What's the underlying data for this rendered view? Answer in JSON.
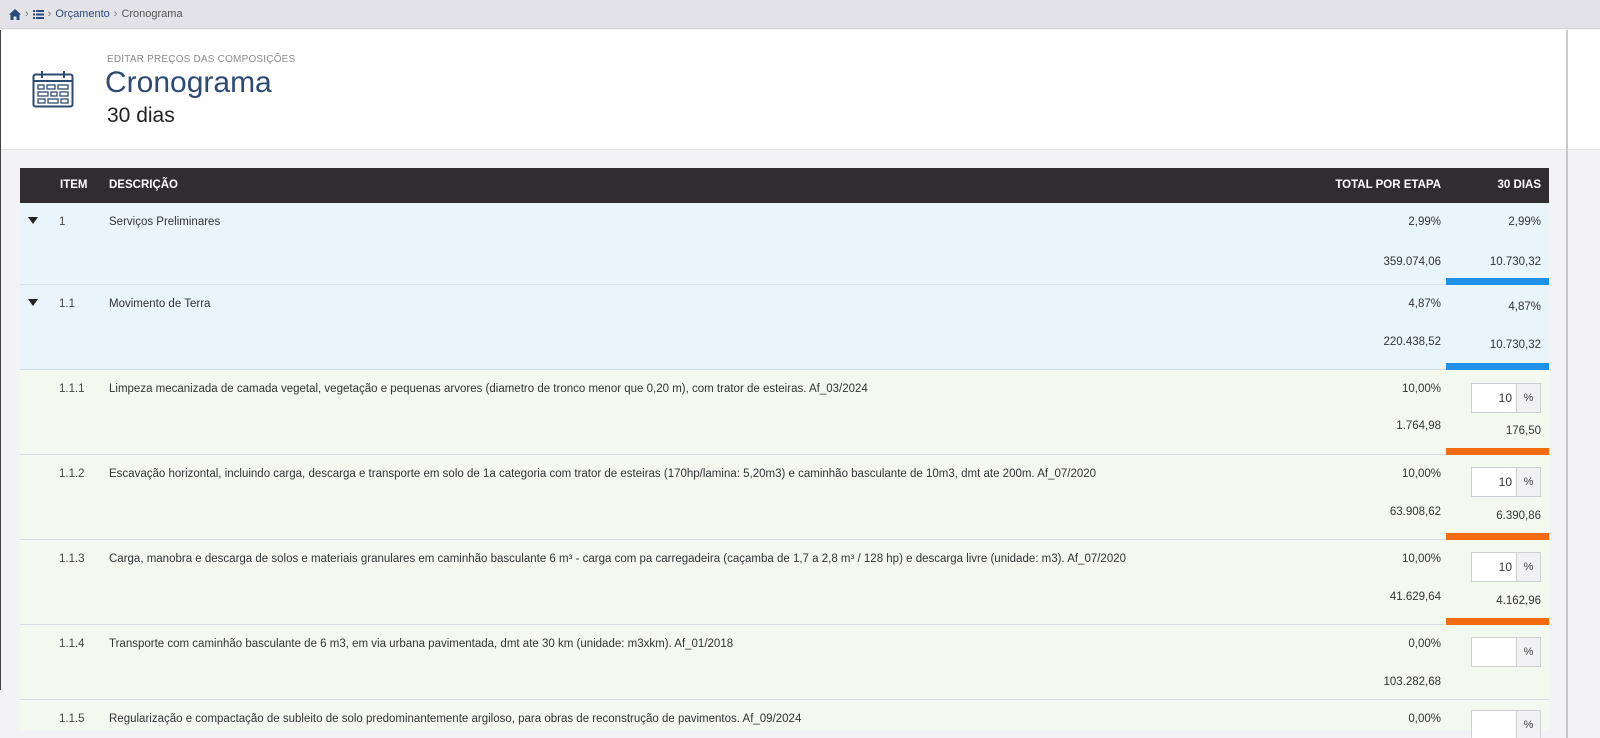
{
  "breadcrumb": {
    "items": [
      "Orçamento",
      "Cronograma"
    ]
  },
  "header": {
    "subtitle": "EDITAR PREÇOS DAS COMPOSIÇÕES",
    "title": "Cronograma",
    "period": "30 dias"
  },
  "table": {
    "columns": {
      "item": "ITEM",
      "description": "DESCRIÇÃO",
      "total": "TOTAL POR ETAPA",
      "days": "30 DIAS"
    },
    "rows": [
      {
        "item": "1",
        "description": "Serviços Preliminares",
        "total_pct": "2,99%",
        "total_value": "359.074,06",
        "day_pct": "2,99%",
        "day_value": "10.730,32"
      },
      {
        "item": "1.1",
        "description": "Movimento de Terra",
        "total_pct": "4,87%",
        "total_value": "220.438,52",
        "day_pct": "4,87%",
        "day_value": "10.730,32"
      },
      {
        "item": "1.1.1",
        "description": "Limpeza mecanizada de camada vegetal, vegetação e pequenas arvores (diametro de tronco menor que 0,20 m), com trator de esteiras. Af_03/2024",
        "total_pct": "10,00%",
        "total_value": "1.764,98",
        "input_value": "10",
        "input_unit": "%",
        "day_value": "176,50"
      },
      {
        "item": "1.1.2",
        "description": "Escavação horizontal, incluindo carga, descarga e transporte em solo de 1a categoria com trator de esteiras (170hp/lamina: 5,20m3) e caminhão basculante de 10m3, dmt ate 200m. Af_07/2020",
        "total_pct": "10,00%",
        "total_value": "63.908,62",
        "input_value": "10",
        "input_unit": "%",
        "day_value": "6.390,86"
      },
      {
        "item": "1.1.3",
        "description": "Carga, manobra e descarga de solos e materiais granulares em caminhão basculante 6 m³ - carga com pa carregadeira (caçamba de 1,7 a 2,8 m³ / 128 hp) e descarga livre (unidade: m3). Af_07/2020",
        "total_pct": "10,00%",
        "total_value": "41.629,64",
        "input_value": "10",
        "input_unit": "%",
        "day_value": "4.162,96"
      },
      {
        "item": "1.1.4",
        "description": "Transporte com caminhão basculante de 6 m3, em via urbana pavimentada, dmt ate 30 km (unidade: m3xkm). Af_01/2018",
        "total_pct": "0,00%",
        "total_value": "103.282,68",
        "input_value": "",
        "input_unit": "%"
      },
      {
        "item": "1.1.5",
        "description": "Regularização e compactação de subleito de solo predominantemente argiloso, para obras de reconstrução de pavimentos. Af_09/2024",
        "total_pct": "0,00%",
        "input_unit": "%"
      }
    ]
  },
  "colors": {
    "group_bar": "#1e90e8",
    "leaf_bar": "#f26a12",
    "title": "#2d4a72",
    "header_bg": "#2f2d30"
  },
  "icons": {
    "home": "home-icon",
    "list": "list-icon",
    "calendar": "calendar-icon",
    "expand": "caret-down-icon"
  }
}
